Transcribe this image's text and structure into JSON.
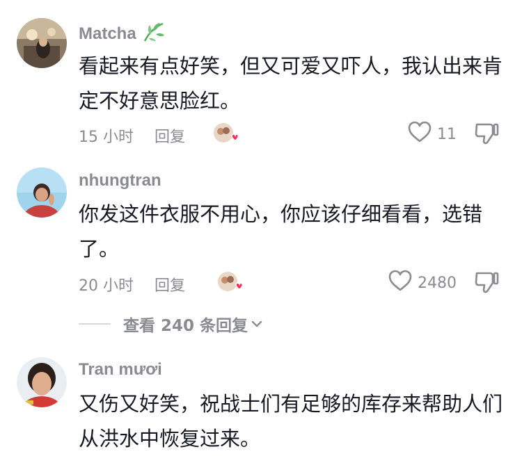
{
  "comments": [
    {
      "username": "Matcha",
      "text": "看起来有点好笑，但又可爱又吓人，我认出来肯定不好意思脸红。",
      "time": "15 小时",
      "reply_label": "回复",
      "likes": "11",
      "icons": {
        "leaf": "leaf-icon",
        "like": "heart-icon",
        "dislike": "thumbs-down-icon"
      }
    },
    {
      "username": "nhungtran",
      "text": "你发这件衣服不用心，你应该仔细看看，选错了。",
      "time": "20 小时",
      "reply_label": "回复",
      "likes": "2480",
      "icons": {
        "like": "heart-icon",
        "dislike": "thumbs-down-icon"
      }
    },
    {
      "username": "Tran mươi",
      "text": "又伤又好笑，祝战士们有足够的库存来帮助人们从洪水中恢复过来。"
    }
  ],
  "view_replies": "查看 240 条回复",
  "colors": {
    "text": "#161823",
    "muted": "#8a8b91",
    "heart_badge": "#fe2c55"
  }
}
